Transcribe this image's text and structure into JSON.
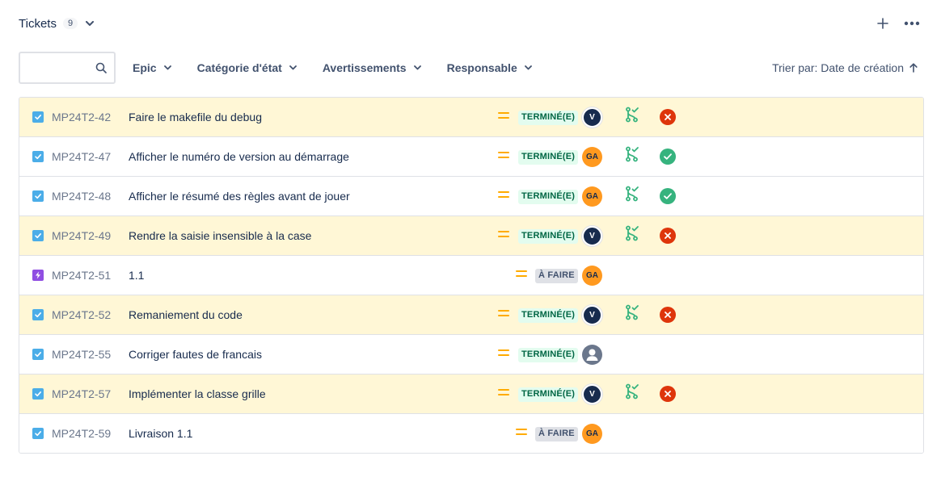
{
  "header": {
    "title": "Tickets",
    "count": "9",
    "icons": {
      "chevron": "chevron-down-icon",
      "add": "plus-icon",
      "more": "more-icon"
    }
  },
  "filters": {
    "search_placeholder": "",
    "search_value": "",
    "epic": "Epic",
    "status_category": "Catégorie d'état",
    "warnings": "Avertissements",
    "assignee": "Responsable",
    "sort_label": "Trier par: Date de création"
  },
  "colors": {
    "highlight": "#fff7d6",
    "done": "#006644",
    "done_bg": "#e3fcef",
    "priority": "#ffab00",
    "fail": "#de350b",
    "ok": "#36b37e",
    "branch": "#36b37e"
  },
  "tickets": [
    {
      "type": "task",
      "key": "MP24T2-42",
      "summary": "Faire le makefile du debug",
      "priority": "medium",
      "status": "TERMINÉ(E)",
      "status_kind": "done",
      "assignee": "V",
      "assignee_kind": "v",
      "branch": true,
      "build": "fail",
      "highlight": true
    },
    {
      "type": "task",
      "key": "MP24T2-47",
      "summary": "Afficher le numéro de version au démarrage",
      "priority": "medium",
      "status": "TERMINÉ(E)",
      "status_kind": "done",
      "assignee": "GA",
      "assignee_kind": "ga",
      "branch": true,
      "build": "ok",
      "highlight": false
    },
    {
      "type": "task",
      "key": "MP24T2-48",
      "summary": "Afficher le résumé des règles avant de jouer",
      "priority": "medium",
      "status": "TERMINÉ(E)",
      "status_kind": "done",
      "assignee": "GA",
      "assignee_kind": "ga",
      "branch": true,
      "build": "ok",
      "highlight": false
    },
    {
      "type": "task",
      "key": "MP24T2-49",
      "summary": "Rendre la saisie insensible à la case",
      "priority": "medium",
      "status": "TERMINÉ(E)",
      "status_kind": "done",
      "assignee": "V",
      "assignee_kind": "v",
      "branch": true,
      "build": "fail",
      "highlight": true
    },
    {
      "type": "story",
      "key": "MP24T2-51",
      "summary": "1.1",
      "priority": "medium",
      "status": "À FAIRE",
      "status_kind": "todo",
      "assignee": "GA",
      "assignee_kind": "ga",
      "branch": false,
      "build": "",
      "highlight": false
    },
    {
      "type": "task",
      "key": "MP24T2-52",
      "summary": "Remaniement du code",
      "priority": "medium",
      "status": "TERMINÉ(E)",
      "status_kind": "done",
      "assignee": "V",
      "assignee_kind": "v",
      "branch": true,
      "build": "fail",
      "highlight": true
    },
    {
      "type": "task",
      "key": "MP24T2-55",
      "summary": "Corriger fautes de francais",
      "priority": "medium",
      "status": "TERMINÉ(E)",
      "status_kind": "done",
      "assignee": "",
      "assignee_kind": "default",
      "branch": false,
      "build": "",
      "highlight": false
    },
    {
      "type": "task",
      "key": "MP24T2-57",
      "summary": "Implémenter la classe grille",
      "priority": "medium",
      "status": "TERMINÉ(E)",
      "status_kind": "done",
      "assignee": "V",
      "assignee_kind": "v",
      "branch": true,
      "build": "fail",
      "highlight": true
    },
    {
      "type": "task",
      "key": "MP24T2-59",
      "summary": "Livraison 1.1",
      "priority": "medium",
      "status": "À FAIRE",
      "status_kind": "todo",
      "assignee": "GA",
      "assignee_kind": "ga",
      "branch": false,
      "build": "",
      "highlight": false
    }
  ]
}
